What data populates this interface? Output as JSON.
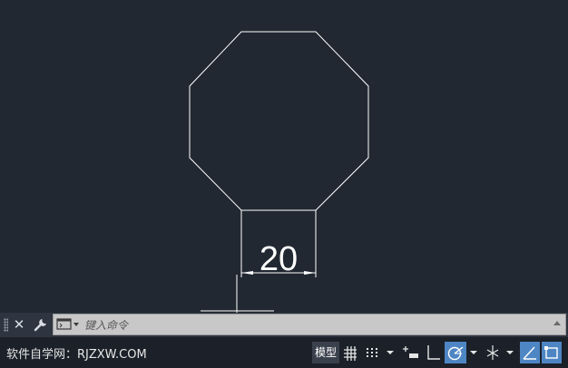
{
  "drawing": {
    "dimension_value": "20"
  },
  "command_line": {
    "placeholder": "键入命令"
  },
  "status_bar": {
    "site_label": "软件自学网：RJZXW.COM",
    "model_tab": "模型"
  },
  "icons": {
    "close": "close-icon",
    "customize": "wrench-icon",
    "prompt": "command-prompt-icon",
    "history": "history-arrow-icon",
    "grid": "grid-icon",
    "snap": "snap-dots-icon",
    "infer": "infer-constraints-icon",
    "ortho": "ortho-mode-icon",
    "polar": "polar-tracking-icon",
    "iso": "isometric-drafting-icon",
    "osnap": "object-snap-tracking-icon",
    "select": "selection-cycling-icon"
  },
  "colors": {
    "canvas": "#212832",
    "linework": "#ffffff",
    "active_toggle": "#4e86c4",
    "command_field": "#c8c8c8"
  }
}
